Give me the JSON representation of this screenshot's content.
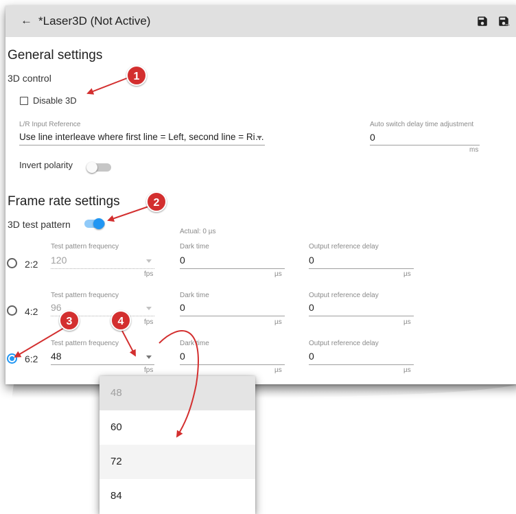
{
  "header": {
    "title": "*Laser3D (Not Active)",
    "back_icon": "arrow-left-icon",
    "save_icons": [
      "save-icon",
      "save-as-icon"
    ]
  },
  "general": {
    "heading": "General settings",
    "control_label": "3D control",
    "disable_3d": {
      "label": "Disable 3D",
      "checked": false
    },
    "lr_input": {
      "label": "L/R Input Reference",
      "value": "Use line interleave where first line = Left, second line = Ri…"
    },
    "auto_switch": {
      "label": "Auto switch delay time adjustment",
      "value": "0",
      "unit": "ms"
    },
    "invert_polarity": {
      "label": "Invert polarity",
      "on": false
    }
  },
  "frame_rate": {
    "heading": "Frame rate settings",
    "test_pattern_label": "3D test pattern",
    "test_pattern_on": true,
    "actual": "Actual: 0 µs",
    "rows": [
      {
        "ratio": "2:2",
        "selected": false,
        "freq_label": "Test pattern frequency",
        "freq": "120",
        "freq_unit": "fps",
        "dark_label": "Dark time",
        "dark": "0",
        "dark_unit": "µs",
        "delay_label": "Output reference delay",
        "delay": "0",
        "delay_unit": "µs"
      },
      {
        "ratio": "4:2",
        "selected": false,
        "freq_label": "Test pattern frequency",
        "freq": "96",
        "freq_unit": "fps",
        "dark_label": "Dark time",
        "dark": "0",
        "dark_unit": "µs",
        "delay_label": "Output reference delay",
        "delay": "0",
        "delay_unit": "µs"
      },
      {
        "ratio": "6:2",
        "selected": true,
        "freq_label": "Test pattern frequency",
        "freq": "48",
        "freq_unit": "fps",
        "dark_label": "Dark time",
        "dark": "0",
        "dark_unit": "µs",
        "delay_label": "Output reference delay",
        "delay": "0",
        "delay_unit": "µs"
      }
    ]
  },
  "dropdown_options": [
    "48",
    "60",
    "72",
    "84"
  ],
  "callouts": [
    "1",
    "2",
    "3",
    "4"
  ],
  "colors": {
    "accent": "#2196f3",
    "callout": "#d32f2f",
    "topbar": "#e0e0e0"
  }
}
